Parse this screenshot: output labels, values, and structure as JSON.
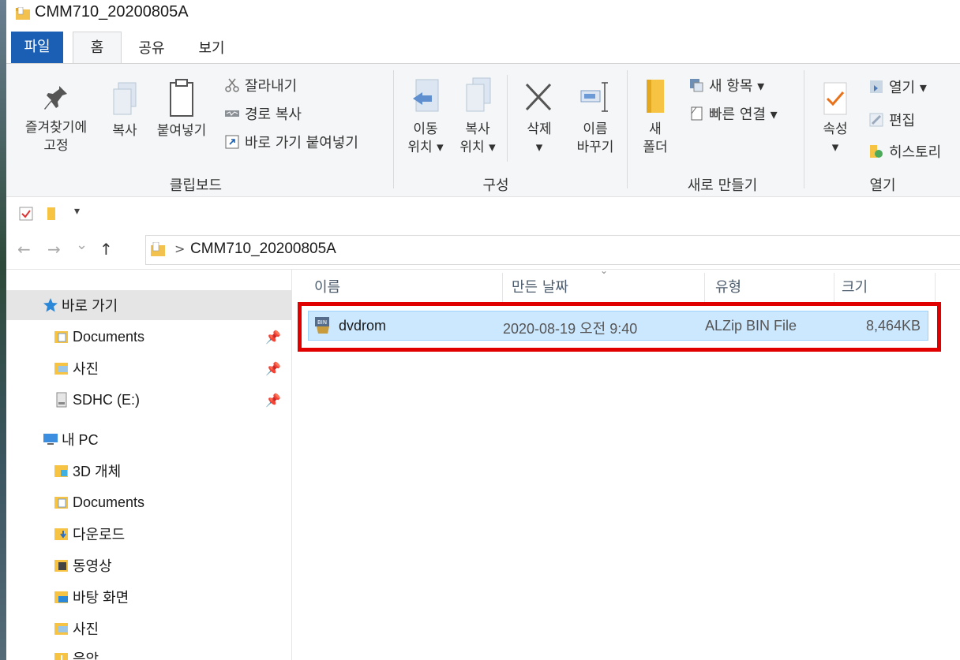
{
  "window": {
    "title": "CMM710_20200805A"
  },
  "tabs": {
    "file": "파일",
    "home": "홈",
    "share": "공유",
    "view": "보기"
  },
  "ribbon": {
    "clipboard": {
      "pin_line1": "즐겨찾기에",
      "pin_line2": "고정",
      "copy": "복사",
      "paste": "붙여넣기",
      "cut": "잘라내기",
      "copy_path": "경로 복사",
      "paste_shortcut": "바로 가기 붙여넣기",
      "label": "클립보드"
    },
    "organize": {
      "move_line1": "이동",
      "move_line2": "위치 ▾",
      "copy_line1": "복사",
      "copy_line2": "위치 ▾",
      "delete_line1": "삭제",
      "delete_line2": "▾",
      "rename_line1": "이름",
      "rename_line2": "바꾸기",
      "label": "구성"
    },
    "new": {
      "folder_line1": "새",
      "folder_line2": "폴더",
      "new_item": "새 항목 ▾",
      "easy_access": "빠른 연결 ▾",
      "label": "새로 만들기"
    },
    "open": {
      "properties_line1": "속성",
      "properties_line2": "▾",
      "open": "열기 ▾",
      "edit": "편집",
      "history": "히스토리",
      "label": "열기"
    }
  },
  "qat": {
    "dropdown": "▾"
  },
  "address": {
    "back": "←",
    "forward": "→",
    "recent": "⌄",
    "up": "↑",
    "sep": ">",
    "path": "CMM710_20200805A"
  },
  "nav_pane": {
    "quick_access": "바로 가기",
    "quick_items": [
      {
        "label": "Documents",
        "pinned": "📌"
      },
      {
        "label": "사진",
        "pinned": "📌"
      },
      {
        "label": "SDHC (E:)",
        "pinned": "📌"
      }
    ],
    "this_pc": "내 PC",
    "pc_items": [
      "3D 개체",
      "Documents",
      "다운로드",
      "동영상",
      "바탕 화면",
      "사진",
      "음악"
    ]
  },
  "columns": {
    "name": "이름",
    "date": "만든 날짜",
    "type": "유형",
    "size": "크기",
    "sort_indicator": "⌄"
  },
  "files": [
    {
      "name": "dvdrom",
      "date": "2020-08-19 오전 9:40",
      "type": "ALZip BIN File",
      "size": "8,464KB"
    }
  ],
  "colors": {
    "selection": "#cce8ff",
    "highlight_border": "#e00000",
    "file_tab": "#1a5fb4"
  }
}
